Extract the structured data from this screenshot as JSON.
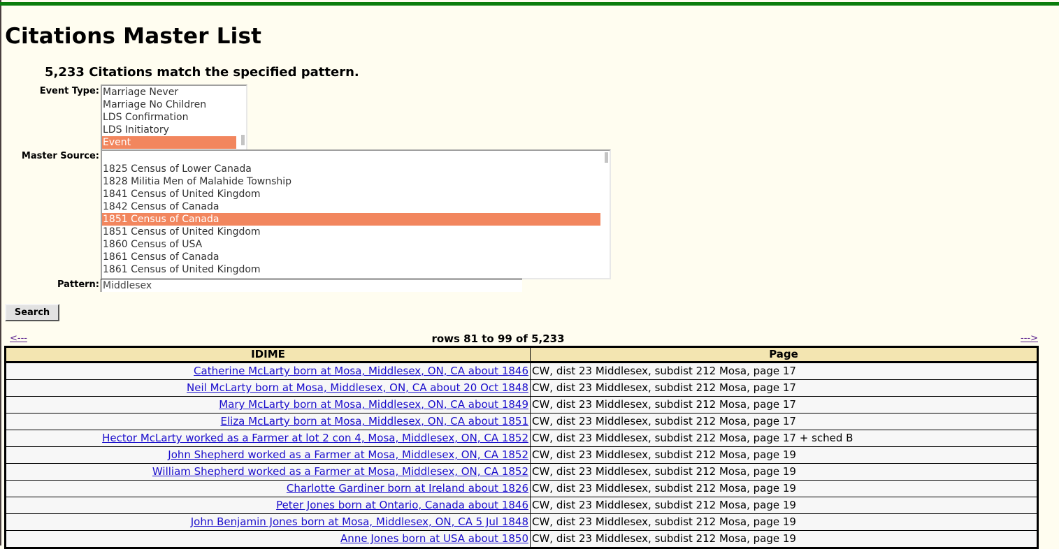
{
  "page": {
    "title": "Citations Master List",
    "count_message": "5,233 Citations match the specified pattern."
  },
  "colors": {
    "top_bar": "#0b7d0b",
    "background": "#fffdf0",
    "selection": "#f2865e",
    "table_header": "#f3e5b1",
    "link": "#1a0dcc"
  },
  "form": {
    "event_type": {
      "label": "Event Type:",
      "options": [
        {
          "label": "Marriage Never",
          "selected": false
        },
        {
          "label": "Marriage No Children",
          "selected": false
        },
        {
          "label": "LDS Confirmation",
          "selected": false
        },
        {
          "label": "LDS Initiatory",
          "selected": false
        },
        {
          "label": "Event",
          "selected": true
        }
      ]
    },
    "master_source": {
      "label": "Master Source:",
      "options": [
        {
          "label": "1825 Census of Lower Canada",
          "selected": false
        },
        {
          "label": "1828 Militia Men of Malahide Township",
          "selected": false
        },
        {
          "label": "1841 Census of United Kingdom",
          "selected": false
        },
        {
          "label": "1842 Census of Canada",
          "selected": false
        },
        {
          "label": "1851 Census of Canada",
          "selected": true
        },
        {
          "label": "1851 Census of United Kingdom",
          "selected": false
        },
        {
          "label": "1860 Census of USA",
          "selected": false
        },
        {
          "label": "1861 Census of Canada",
          "selected": false
        },
        {
          "label": "1861 Census of United Kingdom",
          "selected": false
        }
      ]
    },
    "pattern": {
      "label": "Pattern:",
      "value": "Middlesex"
    },
    "search_button": "Search"
  },
  "pagination": {
    "prev_label": "<---",
    "next_label": "--->",
    "rows_info": "rows 81 to 99 of 5,233"
  },
  "table": {
    "headers": [
      "IDIME",
      "Page"
    ],
    "rows": [
      {
        "idime": "Catherine McLarty born at Mosa, Middlesex, ON, CA about 1846",
        "page": "CW, dist 23 Middlesex, subdist 212 Mosa, page 17"
      },
      {
        "idime": "Neil McLarty born at Mosa, Middlesex, ON, CA about 20 Oct 1848",
        "page": "CW, dist 23 Middlesex, subdist 212 Mosa, page 17"
      },
      {
        "idime": "Mary McLarty born at Mosa, Middlesex, ON, CA about 1849",
        "page": "CW, dist 23 Middlesex, subdist 212 Mosa, page 17"
      },
      {
        "idime": "Eliza McLarty born at Mosa, Middlesex, ON, CA about 1851",
        "page": "CW, dist 23 Middlesex, subdist 212 Mosa, page 17"
      },
      {
        "idime": "Hector McLarty worked as a Farmer at lot 2 con 4, Mosa, Middlesex, ON, CA 1852",
        "page": "CW, dist 23 Middlesex, subdist 212 Mosa, page 17 + sched B"
      },
      {
        "idime": "John Shepherd worked as a Farmer at Mosa, Middlesex, ON, CA 1852",
        "page": "CW, dist 23 Middlesex, subdist 212 Mosa, page 19"
      },
      {
        "idime": "William Shepherd worked as a Farmer at Mosa, Middlesex, ON, CA 1852",
        "page": "CW, dist 23 Middlesex, subdist 212 Mosa, page 19"
      },
      {
        "idime": "Charlotte Gardiner born at Ireland about 1826",
        "page": "CW, dist 23 Middlesex, subdist 212 Mosa, page 19"
      },
      {
        "idime": "Peter Jones born at Ontario, Canada about 1846",
        "page": "CW, dist 23 Middlesex, subdist 212 Mosa, page 19"
      },
      {
        "idime": "John Benjamin Jones born at Mosa, Middlesex, ON, CA 5 Jul 1848",
        "page": "CW, dist 23 Middlesex, subdist 212 Mosa, page 19"
      },
      {
        "idime": "Anne Jones born at USA about 1850",
        "page": "CW, dist 23 Middlesex, subdist 212 Mosa, page 19"
      }
    ]
  }
}
